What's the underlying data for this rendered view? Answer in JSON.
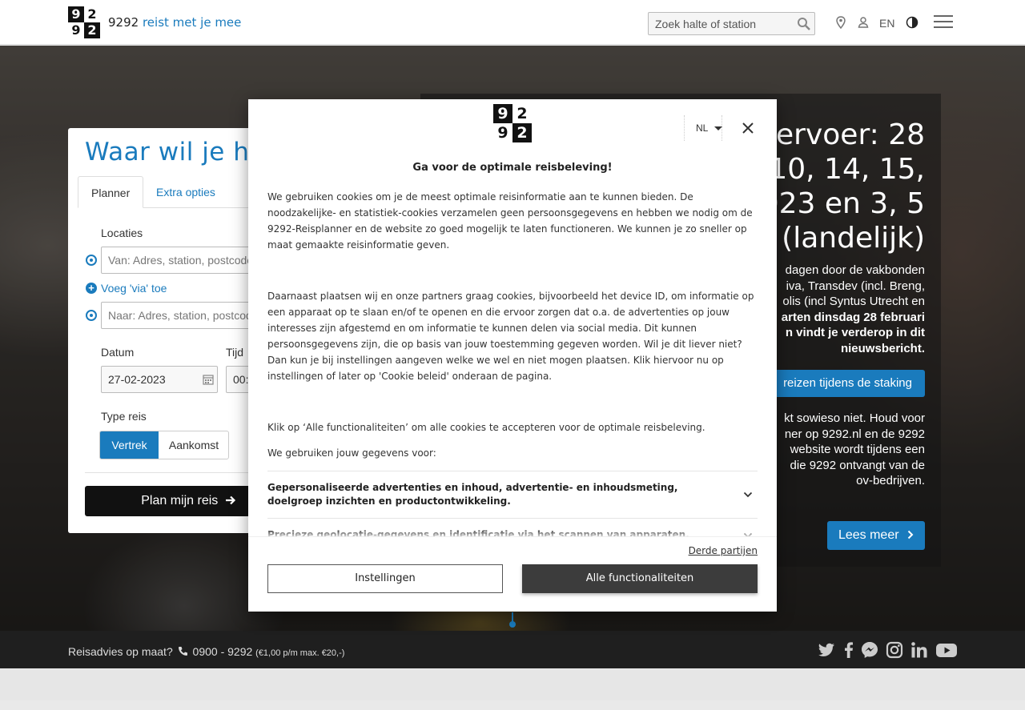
{
  "header": {
    "logo_digits": [
      "9",
      "2",
      "9",
      "2"
    ],
    "brand_name": "9292",
    "brand_tagline": "reist met je mee",
    "search_placeholder": "Zoek halte of station",
    "language": "EN",
    "icons": [
      "map-marker-icon",
      "user-icon",
      "contrast-icon",
      "hamburger-menu-icon"
    ]
  },
  "planner": {
    "title": "Waar wil je heen?",
    "tabs": [
      {
        "label": "Planner",
        "active": true
      },
      {
        "label": "Extra opties",
        "active": false
      }
    ],
    "locations_label": "Locaties",
    "from_placeholder": "Van: Adres, station, postcode",
    "via_label": "Voeg 'via' toe",
    "to_placeholder": "Naar: Adres, station, postcode",
    "date_label": "Datum",
    "date_value": "27-02-2023",
    "time_label": "Tijd",
    "time_value": "00:",
    "type_label": "Type reis",
    "type_options": [
      {
        "label": "Vertrek",
        "selected": true
      },
      {
        "label": "Aankomst",
        "selected": false
      }
    ],
    "submit_label": "Plan mijn reis"
  },
  "news": {
    "title_lines": [
      "vervoer: 28",
      "8, 10, 14, 15,",
      "2023 en 3, 5",
      "(landelijk)"
    ],
    "body_lines": [
      "dagen door de vakbonden",
      "iva, Transdev (incl. Breng,",
      "olis (incl Syntus Utrecht en"
    ],
    "bold_lines": [
      "arten dinsdag 28 februari",
      "n vindt je verderop in dit",
      "nieuwsbericht."
    ],
    "strike_button": "reizen tijdens de staking",
    "body2_lines": [
      "kt sowieso niet. Houd voor",
      "ner op 9292.nl en de 9292",
      "website wordt tijdens een",
      "die 9292 ontvangt van de",
      "ov-bedrijven."
    ],
    "read_more": "Lees meer"
  },
  "footer": {
    "question": "Reisadvies op maat?",
    "phone": "0900 - 9292",
    "price": "(€1,00 p/m max. €20,-)",
    "social": [
      "twitter-icon",
      "facebook-icon",
      "messenger-icon",
      "instagram-icon",
      "linkedin-icon",
      "youtube-icon"
    ]
  },
  "cookie_modal": {
    "language": "NL",
    "title": "Ga voor de optimale reisbeleving!",
    "paragraph1": "We gebruiken cookies om je de meest optimale reisinformatie aan te kunnen bieden. De noodzakelijke- en statistiek-cookies verzamelen geen persoonsgegevens en hebben we nodig om de 9292-Reisplanner en de website zo goed mogelijk te laten functioneren. We kunnen je zo sneller op maat gemaakte reisinformatie geven.",
    "paragraph2": "Daarnaast plaatsen wij en onze partners graag cookies, bijvoorbeeld het device ID, om informatie op een apparaat op te slaan en/of te openen en die ervoor zorgen dat o.a. de advertenties op jouw interesses zijn afgestemd en om informatie te kunnen delen via social media. Dit kunnen persoonsgegevens zijn, die op basis van jouw toestemming gegeven worden. Wil je dit liever niet? Dan kun je bij instellingen aangeven welke we wel en niet mogen plaatsen. Klik hiervoor nu op instellingen of later op 'Cookie beleid' onderaan de pagina.",
    "paragraph3": "Klik op ‘Alle functionaliteiten’ om alle cookies te accepteren voor de optimale reisbeleving.",
    "paragraph4": "We gebruiken jouw gegevens voor:",
    "purposes": [
      "Gepersonaliseerde advertenties en inhoud, advertentie- en inhoudsmeting, doelgroep inzichten en productontwikkeling.",
      "Precieze geolocatie-gegevens en identificatie via het scannen van apparaten."
    ],
    "third_parties": "Derde partijen",
    "settings_button": "Instellingen",
    "accept_button": "Alle functionaliteiten"
  },
  "colors": {
    "brand_blue": "#1a7bbd",
    "dark": "#111111",
    "accept_button": "#3c3c3c"
  }
}
